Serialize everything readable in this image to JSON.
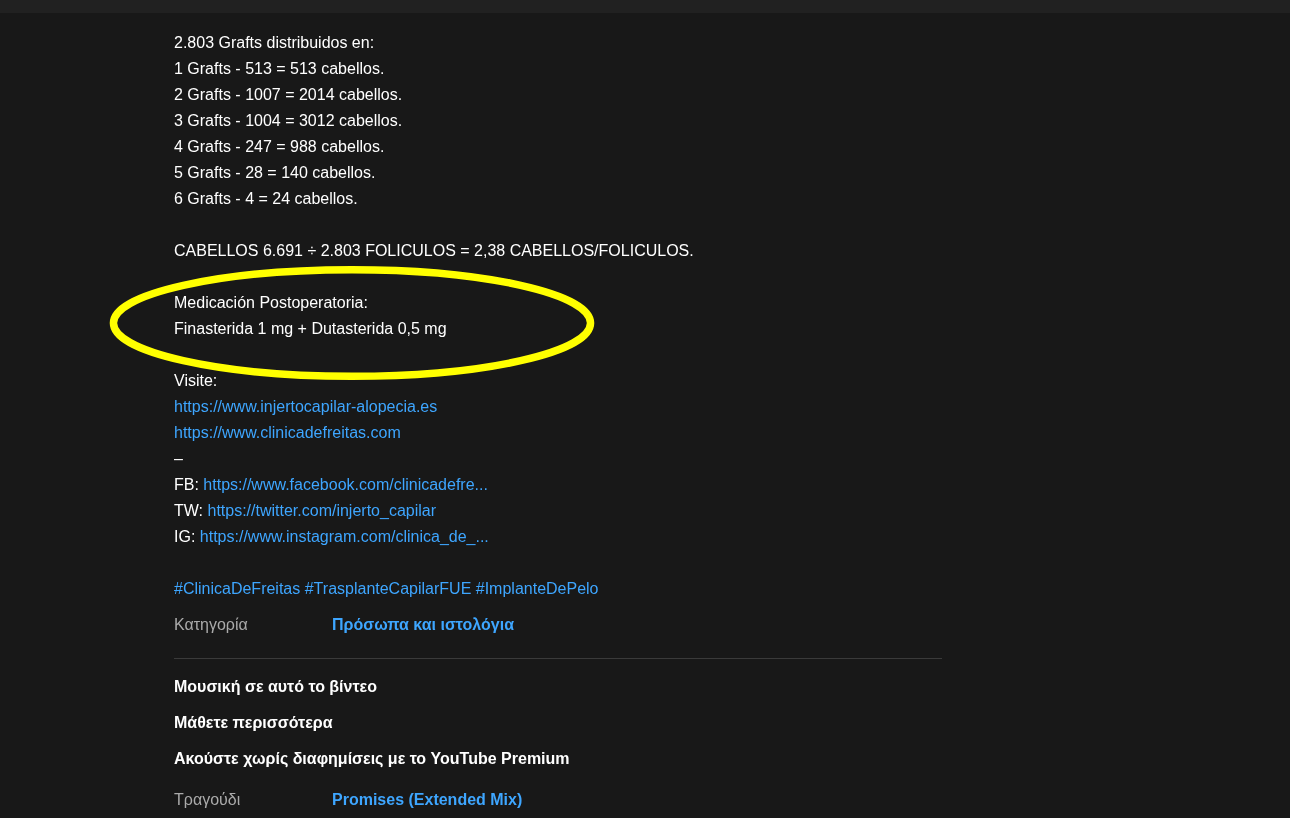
{
  "description": {
    "lines": [
      {
        "kind": "text",
        "text": "2.803 Grafts distribuidos en:"
      },
      {
        "kind": "text",
        "text": "1 Grafts - 513 = 513 cabellos."
      },
      {
        "kind": "text",
        "text": "2 Grafts - 1007 = 2014 cabellos."
      },
      {
        "kind": "text",
        "text": "3 Grafts - 1004 = 3012 cabellos."
      },
      {
        "kind": "text",
        "text": "4 Grafts - 247 = 988 cabellos."
      },
      {
        "kind": "text",
        "text": "5 Grafts - 28 = 140 cabellos."
      },
      {
        "kind": "text",
        "text": "6 Grafts - 4 = 24 cabellos."
      },
      {
        "kind": "blank"
      },
      {
        "kind": "text",
        "text": "CABELLOS 6.691 ÷ 2.803 FOLICULOS = 2,38 CABELLOS/FOLICULOS."
      },
      {
        "kind": "blank"
      },
      {
        "kind": "text",
        "text": "Medicación Postoperatoria:",
        "highlighted": true
      },
      {
        "kind": "text",
        "text": "Finasterida 1 mg + Dutasterida 0,5 mg"
      },
      {
        "kind": "blank"
      },
      {
        "kind": "text",
        "text": "Visite:"
      },
      {
        "kind": "link",
        "url": "https://www.injertocapilar-alopecia.es"
      },
      {
        "kind": "link",
        "url": "https://www.clinicadefreitas.com"
      },
      {
        "kind": "text",
        "text": "–"
      },
      {
        "kind": "labeled_link",
        "label": "FB:",
        "url": "https://www.facebook.com/clinicadefre..."
      },
      {
        "kind": "labeled_link",
        "label": "TW:",
        "url": "https://twitter.com/injerto_capilar"
      },
      {
        "kind": "labeled_link",
        "label": "IG:",
        "url": "https://www.instagram.com/clinica_de_..."
      },
      {
        "kind": "blank"
      },
      {
        "kind": "hashtags",
        "tags": [
          "#ClinicaDeFreitas",
          "#TrasplanteCapilarFUE",
          "#ImplanteDePelo"
        ]
      }
    ]
  },
  "category": {
    "label": "Κατηγορία",
    "value": "Πρόσωπα και ιστολόγια"
  },
  "music": {
    "heading": "Μουσική σε αυτό το βίντεο",
    "learn_more": "Μάθετε περισσότερα",
    "premium": "Ακούστε χωρίς διαφημίσεις με το YouTube Premium",
    "song_label": "Τραγούδι",
    "song": "Promises (Extended Mix)"
  }
}
